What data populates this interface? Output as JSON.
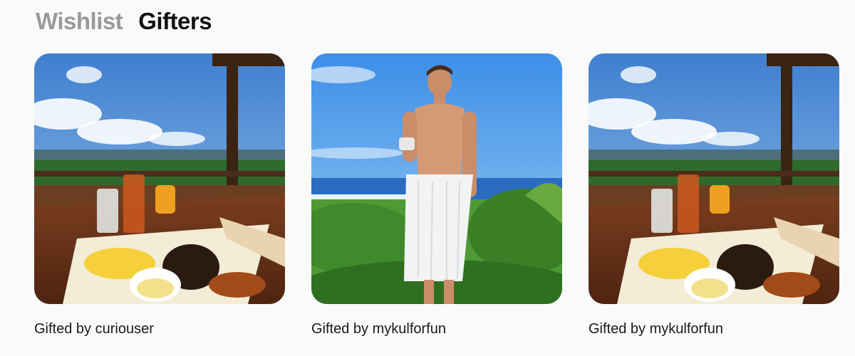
{
  "tabs": [
    {
      "label": "Wishlist",
      "active": false
    },
    {
      "label": "Gifters",
      "active": true
    }
  ],
  "cards": [
    {
      "caption": "Gifted by curiouser",
      "image": "breakfast-table-ocean-view"
    },
    {
      "caption": "Gifted by mykulforfun",
      "image": "man-in-towel-ocean-view"
    },
    {
      "caption": "Gifted by mykulforfun",
      "image": "breakfast-table-ocean-view"
    }
  ],
  "colors": {
    "tab_active": "#111111",
    "tab_inactive": "#9a9a9a",
    "background": "#fafafa"
  }
}
